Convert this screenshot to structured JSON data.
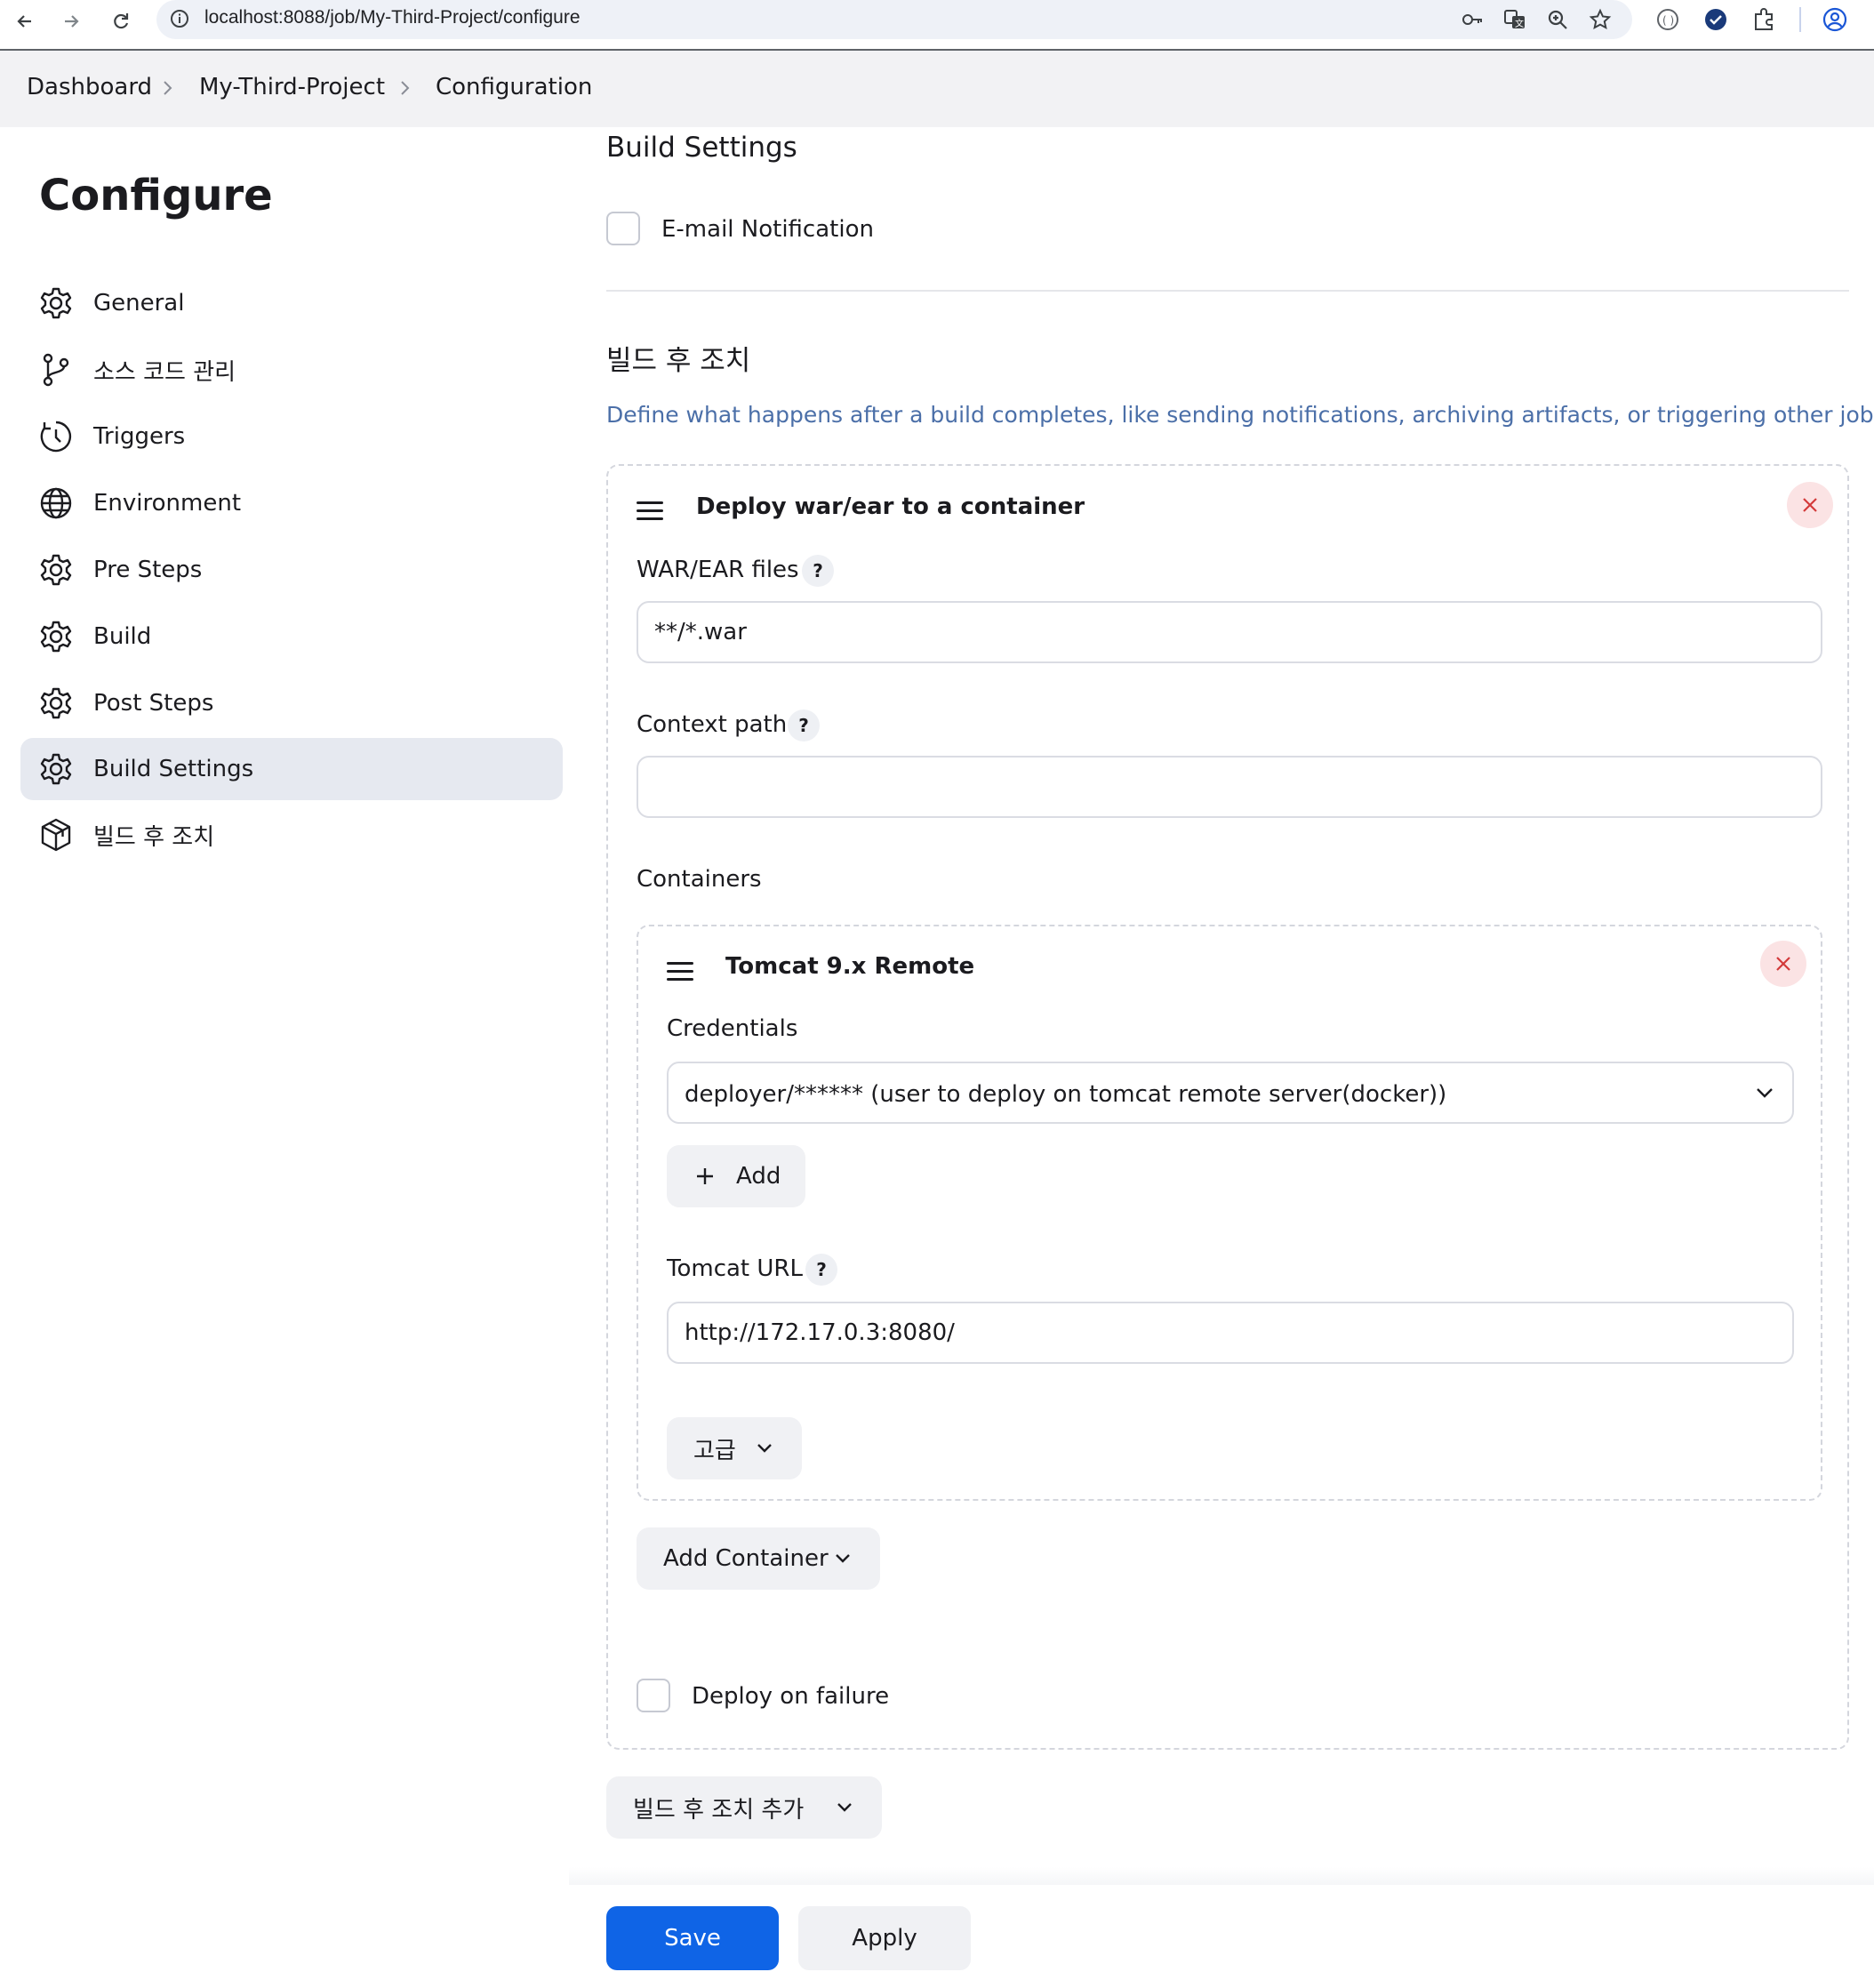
{
  "browser": {
    "url": "localhost:8088/job/My-Third-Project/configure"
  },
  "breadcrumb": {
    "items": [
      "Dashboard",
      "My-Third-Project",
      "Configuration"
    ]
  },
  "sidebar": {
    "title": "Configure",
    "items": [
      {
        "label": "General",
        "icon": "gear-icon"
      },
      {
        "label": "소스 코드 관리",
        "icon": "git-branch-icon"
      },
      {
        "label": "Triggers",
        "icon": "clock-icon"
      },
      {
        "label": "Environment",
        "icon": "globe-icon"
      },
      {
        "label": "Pre Steps",
        "icon": "gear-icon"
      },
      {
        "label": "Build",
        "icon": "gear-icon"
      },
      {
        "label": "Post Steps",
        "icon": "gear-icon"
      },
      {
        "label": "Build Settings",
        "icon": "gear-icon",
        "active": true
      },
      {
        "label": "빌드 후 조치",
        "icon": "package-icon"
      }
    ]
  },
  "build_settings": {
    "heading": "Build Settings",
    "email_label": "E-mail Notification",
    "email_checked": false
  },
  "post_build": {
    "heading": "빌드 후 조치",
    "description": "Define what happens after a build completes, like sending notifications, archiving artifacts, or triggering other jobs.",
    "deploy": {
      "title": "Deploy war/ear to a container",
      "war_label": "WAR/EAR files",
      "war_value": "**/*.war",
      "context_label": "Context path",
      "context_value": "",
      "containers_label": "Containers",
      "container": {
        "title": "Tomcat 9.x Remote",
        "credentials_label": "Credentials",
        "credentials_value": "deployer/****** (user to deploy on tomcat remote server(docker))",
        "add_label": "Add",
        "url_label": "Tomcat URL",
        "url_value": "http://172.17.0.3:8080/",
        "advanced_label": "고급"
      },
      "add_container_label": "Add Container",
      "deploy_failure_label": "Deploy on failure",
      "deploy_failure_checked": false
    },
    "add_action_label": "빌드 후 조치 추가"
  },
  "footer": {
    "save_label": "Save",
    "apply_label": "Apply"
  },
  "colors": {
    "primary": "#0f64e6",
    "description": "#4b6fa8",
    "active_nav": "#e6e9f0",
    "danger_bg": "#fbe3e4"
  },
  "help_mark": "?"
}
